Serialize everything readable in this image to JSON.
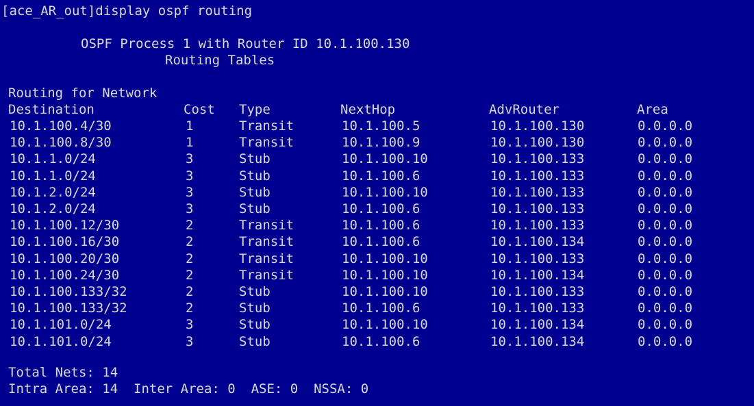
{
  "terminal": {
    "prompt": "[ace_AR_out]display ospf routing",
    "process_line": "OSPF Process 1 with Router ID 10.1.100.130",
    "tables_line": "Routing Tables",
    "section_title": "Routing for Network",
    "columns": [
      "Destination",
      "Cost",
      "Type",
      "NextHop",
      "AdvRouter",
      "Area"
    ],
    "rows": [
      [
        "10.1.100.4/30",
        "1",
        "Transit",
        "10.1.100.5",
        "10.1.100.130",
        "0.0.0.0"
      ],
      [
        "10.1.100.8/30",
        "1",
        "Transit",
        "10.1.100.9",
        "10.1.100.130",
        "0.0.0.0"
      ],
      [
        "10.1.1.0/24",
        "3",
        "Stub",
        "10.1.100.10",
        "10.1.100.133",
        "0.0.0.0"
      ],
      [
        "10.1.1.0/24",
        "3",
        "Stub",
        "10.1.100.6",
        "10.1.100.133",
        "0.0.0.0"
      ],
      [
        "10.1.2.0/24",
        "3",
        "Stub",
        "10.1.100.10",
        "10.1.100.133",
        "0.0.0.0"
      ],
      [
        "10.1.2.0/24",
        "3",
        "Stub",
        "10.1.100.6",
        "10.1.100.133",
        "0.0.0.0"
      ],
      [
        "10.1.100.12/30",
        "2",
        "Transit",
        "10.1.100.6",
        "10.1.100.133",
        "0.0.0.0"
      ],
      [
        "10.1.100.16/30",
        "2",
        "Transit",
        "10.1.100.6",
        "10.1.100.134",
        "0.0.0.0"
      ],
      [
        "10.1.100.20/30",
        "2",
        "Transit",
        "10.1.100.10",
        "10.1.100.133",
        "0.0.0.0"
      ],
      [
        "10.1.100.24/30",
        "2",
        "Transit",
        "10.1.100.10",
        "10.1.100.134",
        "0.0.0.0"
      ],
      [
        "10.1.100.133/32",
        "2",
        "Stub",
        "10.1.100.10",
        "10.1.100.133",
        "0.0.0.0"
      ],
      [
        "10.1.100.133/32",
        "2",
        "Stub",
        "10.1.100.6",
        "10.1.100.133",
        "0.0.0.0"
      ],
      [
        "10.1.101.0/24",
        "3",
        "Stub",
        "10.1.100.10",
        "10.1.100.134",
        "0.0.0.0"
      ],
      [
        "10.1.101.0/24",
        "3",
        "Stub",
        "10.1.100.6",
        "10.1.100.134",
        "0.0.0.0"
      ]
    ],
    "summary": {
      "total_nets": "Total Nets: 14",
      "area_line": "Intra Area: 14  Inter Area: 0  ASE: 0  NSSA: 0"
    }
  }
}
